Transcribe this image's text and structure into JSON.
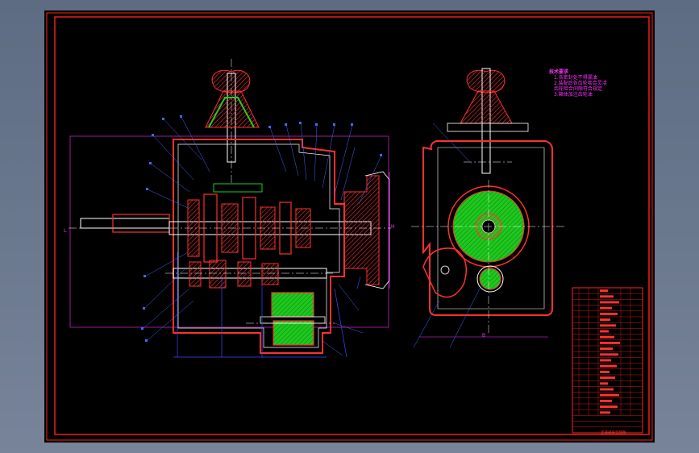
{
  "drawing": {
    "tech_notes": {
      "title": "技术要求",
      "items": [
        "1.各密封处不得漏油",
        "2.装配后各齿轮啮合灵活",
        "齿轮啮合间隙符合规定",
        "3.箱体加注齿轮油"
      ]
    },
    "dimension_labels": [
      "L",
      "H",
      "B"
    ],
    "title_block": {
      "row_count": 25,
      "footer_label": "变速器总装配图"
    },
    "colors": {
      "frame": "#ff2020",
      "outline": "#ffffff",
      "center": "#ffffff",
      "dimension": "#3a4cff",
      "section_fill": "#22cc22",
      "hatch": "#ff3030",
      "leader": "#4466ff",
      "note": "#ff33ff"
    }
  }
}
